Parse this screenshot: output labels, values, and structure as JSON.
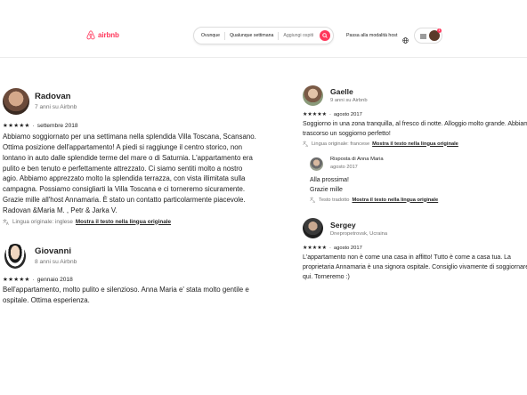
{
  "header": {
    "brand": "airbnb",
    "search": {
      "where": "Ovunque",
      "when": "Qualunque settimana",
      "guests": "Aggiungi ospiti"
    },
    "host_link": "Passa alla modalità host",
    "notification_count": "1"
  },
  "reviews_left": [
    {
      "name": "Radovan",
      "member_since": "7 anni su Airbnb",
      "stars": "★★★★★",
      "date": "settembre 2018",
      "lines": [
        "Abbiamo soggiornato per una settimana nella splendida Villa Toscana, Scansano.",
        "Ottima posizione dell'appartamento! A piedi si raggiunge il centro storico, non",
        "lontano in auto dalle splendide terme del mare o di Saturnia. L'appartamento era",
        "pulito e ben tenuto e perfettamente attrezzato. Ci siamo sentiti molto a nostro",
        "agio. Abbiamo apprezzato molto la splendida terrazza, con vista illimitata sulla",
        "campagna. Possiamo consigliarti la Villa Toscana e ci torneremo sicuramente.",
        "Grazie mille all'host Annamaria. È stato un contatto particolarmente piacevole.",
        "Radovan &Maria M. , Petr & Jarka V."
      ],
      "translation_label": "Lingua originale: inglese",
      "translation_link": "Mostra il testo nella lingua originale"
    },
    {
      "name": "Giovanni",
      "member_since": "8 anni su Airbnb",
      "stars": "★★★★★",
      "date": "gennaio 2018",
      "lines": [
        "Bell'appartamento, molto pulito e silenzioso. Anna Maria e' stata molto gentile e",
        "ospitale. Ottima esperienza."
      ]
    }
  ],
  "reviews_right": [
    {
      "name": "Gaelle",
      "member_since": "9 anni su Airbnb",
      "stars": "★★★★★",
      "date": "agosto 2017",
      "lines": [
        "Soggiorno in una zona tranquilla, al fresco di notte. Alloggio molto grande. Abbiamo",
        "trascorso un soggiorno perfetto!"
      ],
      "translation_label": "Lingua originale: francese",
      "translation_link": "Mostra il testo nella lingua originale",
      "reply": {
        "title": "Risposta di Anna Maria",
        "date": "agosto 2017",
        "lines": [
          "Alla prossima!",
          "Grazie mille"
        ],
        "translation_label": "Testo tradotto",
        "translation_link": "Mostra il testo nella lingua originale"
      }
    },
    {
      "name": "Sergey",
      "location": "Dnepropetrovsk, Ucraina",
      "stars": "★★★★★",
      "date": "agosto 2017",
      "lines": [
        "L'appartamento non è come una casa in affitto! Tutto è come a casa tua. La",
        "proprietaria Annamaria è una signora ospitale. Consiglio vivamente di soggiornare",
        "qui. Torneremo :)"
      ]
    }
  ],
  "colors": {
    "brand": "#ff385c",
    "text": "#222222",
    "muted": "#717171"
  }
}
